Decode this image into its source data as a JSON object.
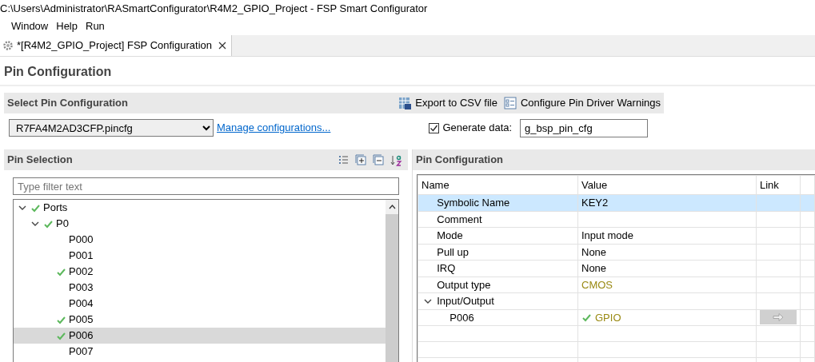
{
  "window": {
    "title": "C:\\Users\\Administrator\\RASmartConfigurator\\R4M2_GPIO_Project - FSP Smart Configurator"
  },
  "menu": [
    {
      "label": "Window"
    },
    {
      "label": "Help"
    },
    {
      "label": "Run"
    }
  ],
  "editor_tab": {
    "label": "*[R4M2_GPIO_Project] FSP Configuration",
    "selected": true
  },
  "page_title": "Pin Configuration",
  "select_section": {
    "title": "Select Pin Configuration",
    "actions": [
      {
        "kind": "export",
        "label": "Export to CSV file"
      },
      {
        "kind": "warnings",
        "label": "Configure Pin Driver Warnings"
      }
    ],
    "config_file": "R7FA4M2AD3CFP.pincfg",
    "manage_link": "Manage configurations...",
    "generate_data": {
      "label": "Generate data:",
      "checked": true,
      "value": "g_bsp_pin_cfg"
    }
  },
  "pin_selection": {
    "title": "Pin Selection",
    "filter_placeholder": "Type filter text",
    "tree": [
      {
        "label": "Ports",
        "configured": true,
        "expanded": true,
        "selected": false,
        "children": [
          {
            "label": "P0",
            "configured": true,
            "expanded": true,
            "selected": false,
            "children": [
              {
                "label": "P000",
                "configured": false,
                "selected": false
              },
              {
                "label": "P001",
                "configured": false,
                "selected": false
              },
              {
                "label": "P002",
                "configured": true,
                "selected": false
              },
              {
                "label": "P003",
                "configured": false,
                "selected": false
              },
              {
                "label": "P004",
                "configured": false,
                "selected": false
              },
              {
                "label": "P005",
                "configured": true,
                "selected": false
              },
              {
                "label": "P006",
                "configured": true,
                "selected": true
              },
              {
                "label": "P007",
                "configured": false,
                "selected": false
              }
            ]
          }
        ]
      }
    ]
  },
  "pin_configuration": {
    "title": "Pin Configuration",
    "columns": [
      "Name",
      "Value",
      "Link"
    ],
    "rows": [
      {
        "name": "Symbolic Name",
        "value": "KEY2",
        "color": "#000000",
        "selected": true
      },
      {
        "name": "Comment",
        "selected": false
      },
      {
        "name": "Mode",
        "value": "Input mode",
        "color": "#000000",
        "selected": false
      },
      {
        "name": "Pull up",
        "value": "None",
        "color": "#000000",
        "selected": false
      },
      {
        "name": "IRQ",
        "value": "None",
        "color": "#000000",
        "selected": false
      },
      {
        "name": "Output type",
        "value": "CMOS",
        "color": "#9a8a14",
        "selected": false
      },
      {
        "name": "Input/Output",
        "expanded": true,
        "selected": false,
        "children": [
          {
            "name": "P006",
            "value": "GPIO",
            "color": "#9a8a14",
            "configured": true,
            "link": true,
            "selected": false
          }
        ]
      }
    ]
  }
}
